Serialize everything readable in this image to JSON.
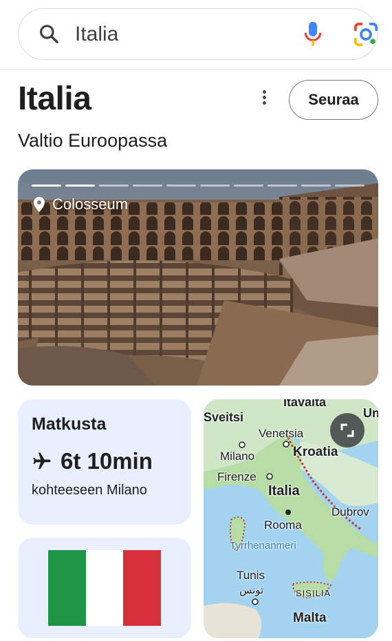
{
  "search": {
    "query": "Italia"
  },
  "entity": {
    "title": "Italia",
    "subtitle": "Valtio Euroopassa",
    "follow_label": "Seuraa"
  },
  "photo": {
    "place": "Colosseum",
    "slides_total": 10,
    "slides_active": 2
  },
  "travel": {
    "heading": "Matkusta",
    "duration": "6t 10min",
    "destination": "kohteeseen Milano"
  },
  "flag": {
    "colors": [
      "#1e9447",
      "#ffffff",
      "#d6303c"
    ]
  },
  "map": {
    "labels": {
      "itavalta": "Itävalta",
      "sveitsi": "Sveitsi",
      "venetsia": "Venetsia",
      "milano": "Milano",
      "kroatia": "Kroatia",
      "firenze": "Firenze",
      "italia": "Italia",
      "dubrov": "Dubrov",
      "rooma": "Rooma",
      "tyrrhenanmeri": "Tyrrhenanmeri",
      "tunis": "Tunis",
      "tunis_ar": "تونس",
      "sisilia": "SISILIA",
      "malta": "Malta",
      "un": "Un"
    }
  }
}
